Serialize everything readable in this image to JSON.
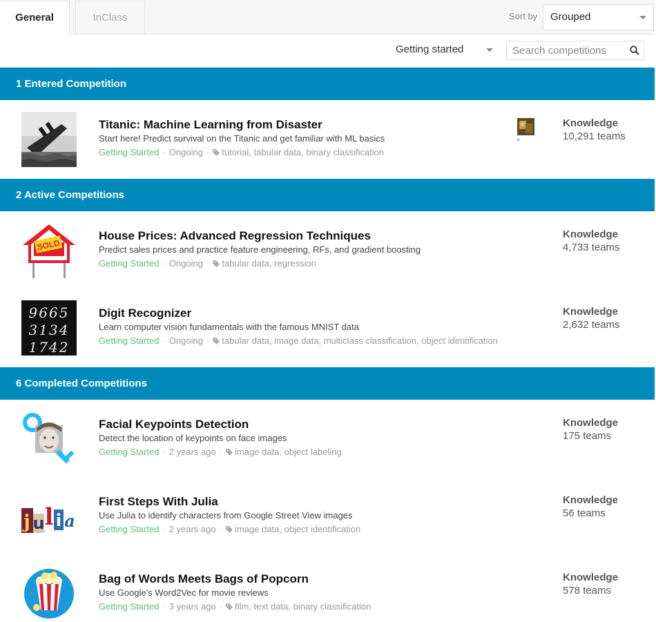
{
  "tabs": {
    "general": "General",
    "inclass": "InClass"
  },
  "sort": {
    "label": "Sort by",
    "value": "Grouped"
  },
  "filter": {
    "category": "Getting started",
    "search_placeholder": "Search competitions"
  },
  "sections": {
    "entered": "1 Entered Competition",
    "active": "2 Active Competitions",
    "completed": "6 Completed Competitions"
  },
  "competitions": [
    {
      "title": "Titanic: Machine Learning from Disaster",
      "description": "Start here! Predict survival on the Titanic and get familiar with ML basics",
      "category": "Getting Started",
      "status": "Ongoing",
      "tags": "tutorial, tabular data, binary classification",
      "reward": "Knowledge",
      "teams": "10,291 teams",
      "thumb_icon": "titanic-ship-icon"
    },
    {
      "title": "House Prices: Advanced Regression Techniques",
      "description": "Predict sales prices and practice feature engineering, RFs, and gradient boosting",
      "category": "Getting Started",
      "status": "Ongoing",
      "tags": "tabular data, regression",
      "reward": "Knowledge",
      "teams": "4,733 teams",
      "thumb_icon": "sold-house-icon",
      "thumb_text": "SOLD"
    },
    {
      "title": "Digit Recognizer",
      "description": "Learn computer vision fundamentals with the famous MNIST data",
      "category": "Getting Started",
      "status": "Ongoing",
      "tags": "tabular data, image data, multiclass classification, object identification",
      "reward": "Knowledge",
      "teams": "2,632 teams",
      "thumb_icon": "mnist-digits-icon",
      "thumb_text": [
        "9665",
        "3134",
        "1742"
      ]
    },
    {
      "title": "Facial Keypoints Detection",
      "description": "Detect the location of keypoints on face images",
      "category": "Getting Started",
      "status": "2 years ago",
      "tags": "image data, object labeling",
      "reward": "Knowledge",
      "teams": "175 teams",
      "thumb_icon": "face-keypoints-icon"
    },
    {
      "title": "First Steps With Julia",
      "description": "Use Julia to identify characters from Google Street View images",
      "category": "Getting Started",
      "status": "2 years ago",
      "tags": "image data, object identification",
      "reward": "Knowledge",
      "teams": "56 teams",
      "thumb_icon": "julia-letters-icon",
      "thumb_text": [
        "j",
        "u",
        "l",
        "i",
        "a"
      ]
    },
    {
      "title": "Bag of Words Meets Bags of Popcorn",
      "description": "Use Google's Word2Vec for movie reviews",
      "category": "Getting Started",
      "status": "3 years ago",
      "tags": "film, text data, binary classification",
      "reward": "Knowledge",
      "teams": "578 teams",
      "thumb_icon": "popcorn-icon"
    }
  ],
  "colors": {
    "section_header": "#008abc",
    "category_green": "#5fbb7f",
    "team_dot": "#20beff"
  }
}
